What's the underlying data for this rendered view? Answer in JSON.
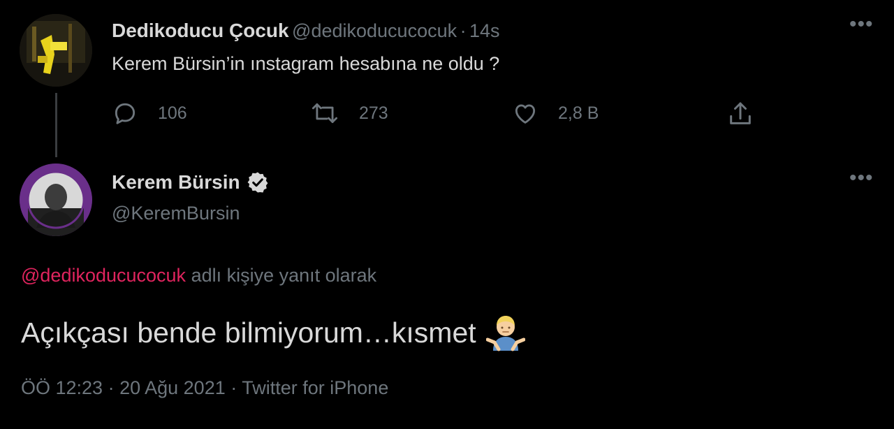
{
  "parent_tweet": {
    "display_name": "Dedikoducu Çocuk",
    "handle": "@dedikoducucocuk",
    "separator": "·",
    "time": "14s",
    "text": "Kerem Bürsin’in ınstagram hesabına ne oldu ?",
    "replies": "106",
    "retweets": "273",
    "likes": "2,8 B",
    "more_label": "•••"
  },
  "main_tweet": {
    "display_name": "Kerem Bürsin",
    "handle": "@KeremBursin",
    "more_label": "•••",
    "reply_to_mention": "@dedikoducucocuk",
    "reply_to_suffix": " adlı kişiye yanıt olarak",
    "text": "Açıkçası bende bilmiyorum…kısmet",
    "emoji": "🤷‍♂️",
    "time": "ÖÖ 12:23",
    "date": "20 Ağu 2021",
    "source": "Twitter for iPhone",
    "meta_separator": " · "
  },
  "colors": {
    "background": "#000000",
    "primary_text": "#d9d9d9",
    "secondary_text": "#6e767d",
    "mention": "#e0245e",
    "verified_badge": "#d9d9d9"
  },
  "icons": [
    "reply-icon",
    "retweet-icon",
    "like-icon",
    "share-icon",
    "verified-badge-icon",
    "more-icon"
  ]
}
